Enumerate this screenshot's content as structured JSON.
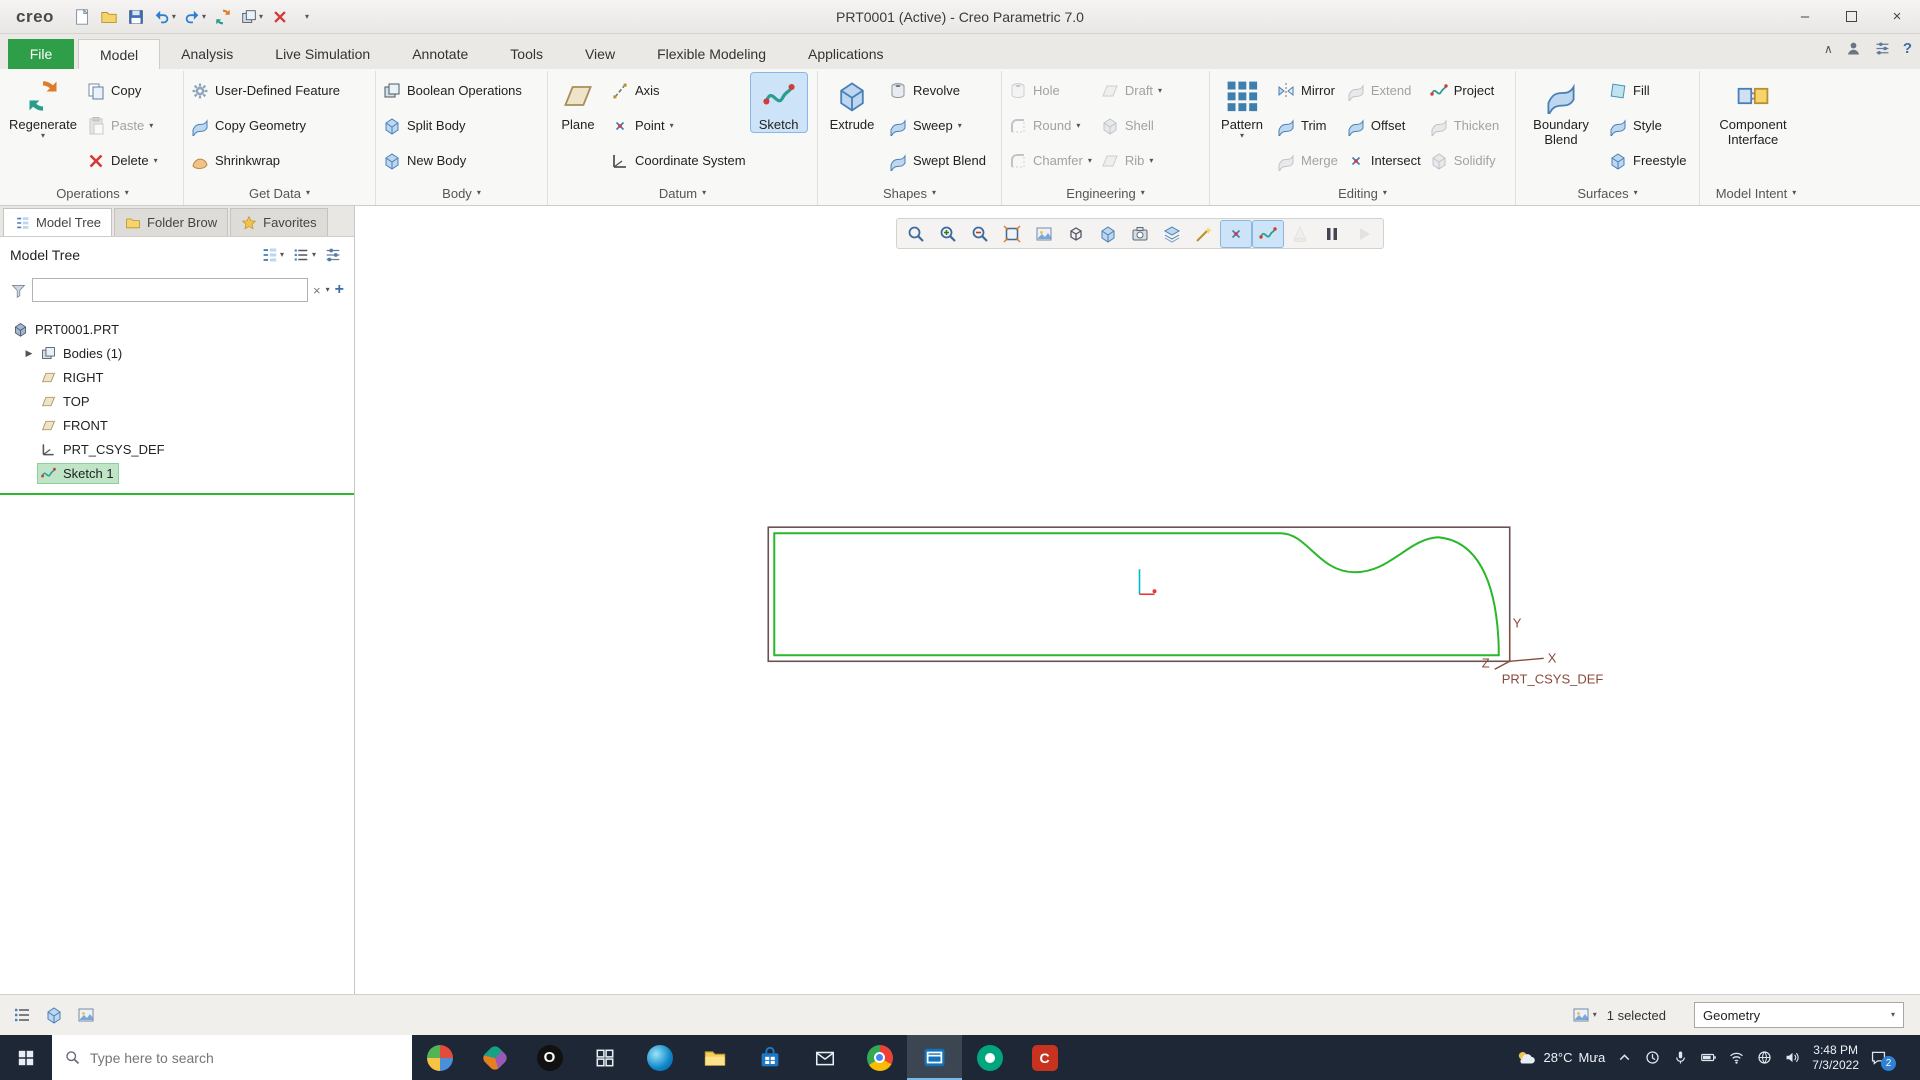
{
  "titlebar": {
    "brand": "creo",
    "title": "PRT0001 (Active) - Creo Parametric 7.0"
  },
  "tabs": {
    "file": "File",
    "model": "Model",
    "analysis": "Analysis",
    "live_simulation": "Live Simulation",
    "annotate": "Annotate",
    "tools": "Tools",
    "view": "View",
    "flexible_modeling": "Flexible Modeling",
    "applications": "Applications"
  },
  "ribbon": {
    "operations": {
      "label": "Operations",
      "regenerate": "Regenerate",
      "copy": "Copy",
      "paste": "Paste",
      "delete": "Delete"
    },
    "get_data": {
      "label": "Get Data",
      "udf": "User-Defined Feature",
      "copy_geometry": "Copy Geometry",
      "shrinkwrap": "Shrinkwrap"
    },
    "body": {
      "label": "Body",
      "boolean_operations": "Boolean Operations",
      "split_body": "Split Body",
      "new_body": "New Body"
    },
    "datum": {
      "label": "Datum",
      "plane": "Plane",
      "axis": "Axis",
      "point": "Point",
      "coordinate_system": "Coordinate System",
      "sketch": "Sketch"
    },
    "shapes": {
      "label": "Shapes",
      "extrude": "Extrude",
      "revolve": "Revolve",
      "sweep": "Sweep",
      "swept_blend": "Swept Blend"
    },
    "engineering": {
      "label": "Engineering",
      "hole": "Hole",
      "draft": "Draft",
      "round": "Round",
      "shell": "Shell",
      "chamfer": "Chamfer",
      "rib": "Rib"
    },
    "editing": {
      "label": "Editing",
      "pattern": "Pattern",
      "mirror": "Mirror",
      "trim": "Trim",
      "merge": "Merge",
      "extend": "Extend",
      "offset": "Offset",
      "intersect": "Intersect",
      "project": "Project",
      "thicken": "Thicken",
      "solidify": "Solidify"
    },
    "surfaces": {
      "label": "Surfaces",
      "boundary_blend": "Boundary Blend",
      "fill": "Fill",
      "style": "Style",
      "freestyle": "Freestyle"
    },
    "model_intent": {
      "label": "Model Intent",
      "component_interface": "Component Interface"
    }
  },
  "panel": {
    "tab_model_tree": "Model Tree",
    "tab_folder_browser": "Folder Brow",
    "tab_favorites": "Favorites",
    "header": "Model Tree",
    "tree": [
      {
        "label": "PRT0001.PRT"
      },
      {
        "label": "Bodies (1)"
      },
      {
        "label": "RIGHT"
      },
      {
        "label": "TOP"
      },
      {
        "label": "FRONT"
      },
      {
        "label": "PRT_CSYS_DEF"
      },
      {
        "label": "Sketch 1"
      }
    ]
  },
  "canvas": {
    "csys_label": "PRT_CSYS_DEF",
    "axis_x": "X",
    "axis_y": "Y",
    "axis_z": "Z"
  },
  "statusbar": {
    "selected": "1 selected",
    "filter": "Geometry"
  },
  "taskbar": {
    "search_placeholder": "Type here to search",
    "weather_temp": "28°C",
    "weather_cond": "Mưa",
    "time": "3:48 PM",
    "date": "7/3/2022",
    "notifications": "2"
  }
}
